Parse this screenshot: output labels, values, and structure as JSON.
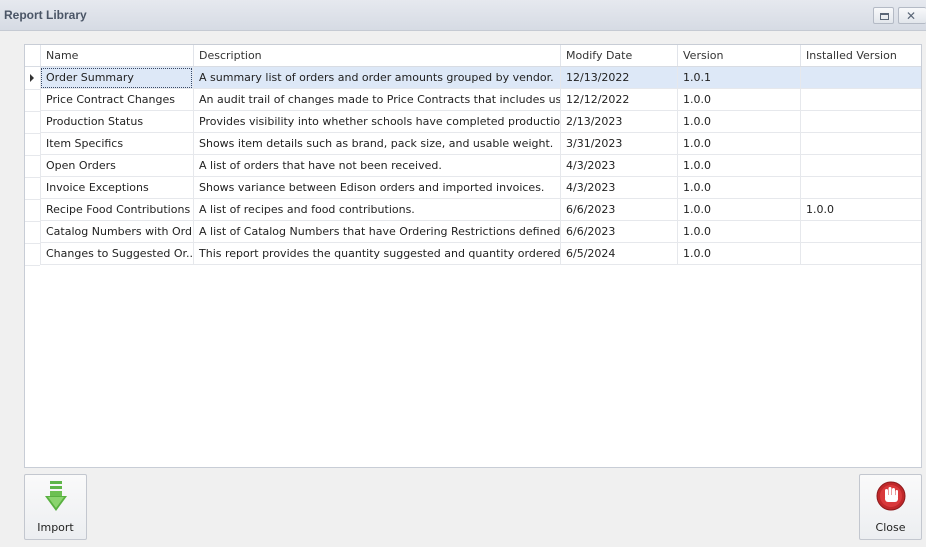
{
  "window": {
    "title": "Report Library"
  },
  "columns": [
    "Name",
    "Description",
    "Modify Date",
    "Version",
    "Installed Version"
  ],
  "rows": [
    {
      "name": "Order Summary",
      "description": "A summary list of orders and order amounts grouped by vendor.",
      "modify_date": "12/13/2022",
      "version": "1.0.1",
      "installed_version": ""
    },
    {
      "name": "Price Contract Changes",
      "description": "An audit trail of changes made to Price Contracts that includes users...",
      "modify_date": "12/12/2022",
      "version": "1.0.0",
      "installed_version": ""
    },
    {
      "name": "Production Status",
      "description": "Provides visibility into whether schools have completed production.",
      "modify_date": "2/13/2023",
      "version": "1.0.0",
      "installed_version": ""
    },
    {
      "name": "Item Specifics",
      "description": "Shows item details such as brand, pack size, and usable weight.",
      "modify_date": "3/31/2023",
      "version": "1.0.0",
      "installed_version": ""
    },
    {
      "name": "Open Orders",
      "description": "A list of orders that have not been received.",
      "modify_date": "4/3/2023",
      "version": "1.0.0",
      "installed_version": ""
    },
    {
      "name": "Invoice Exceptions",
      "description": "Shows variance between Edison orders and imported invoices.",
      "modify_date": "4/3/2023",
      "version": "1.0.0",
      "installed_version": ""
    },
    {
      "name": "Recipe Food Contributions",
      "description": "A list of recipes and food contributions.",
      "modify_date": "6/6/2023",
      "version": "1.0.0",
      "installed_version": "1.0.0"
    },
    {
      "name": "Catalog Numbers with Ord...",
      "description": "A list of Catalog Numbers that have Ordering Restrictions defined.",
      "modify_date": "6/6/2023",
      "version": "1.0.0",
      "installed_version": ""
    },
    {
      "name": "Changes to Suggested Or...",
      "description": "This report provides the quantity suggested and quantity ordered fo...",
      "modify_date": "6/5/2024",
      "version": "1.0.0",
      "installed_version": ""
    }
  ],
  "selected_row": 0,
  "buttons": {
    "import_label": "Import",
    "close_label": "Close"
  },
  "icons": {
    "import": "import-arrow-icon",
    "close": "stop-hand-icon",
    "maximize": "maximize-icon",
    "window_close": "close-icon"
  },
  "colors": {
    "selection": "#dde8f7",
    "title_text": "#4a5566",
    "close_icon": "#c0282a",
    "import_icon": "#5fb548"
  }
}
